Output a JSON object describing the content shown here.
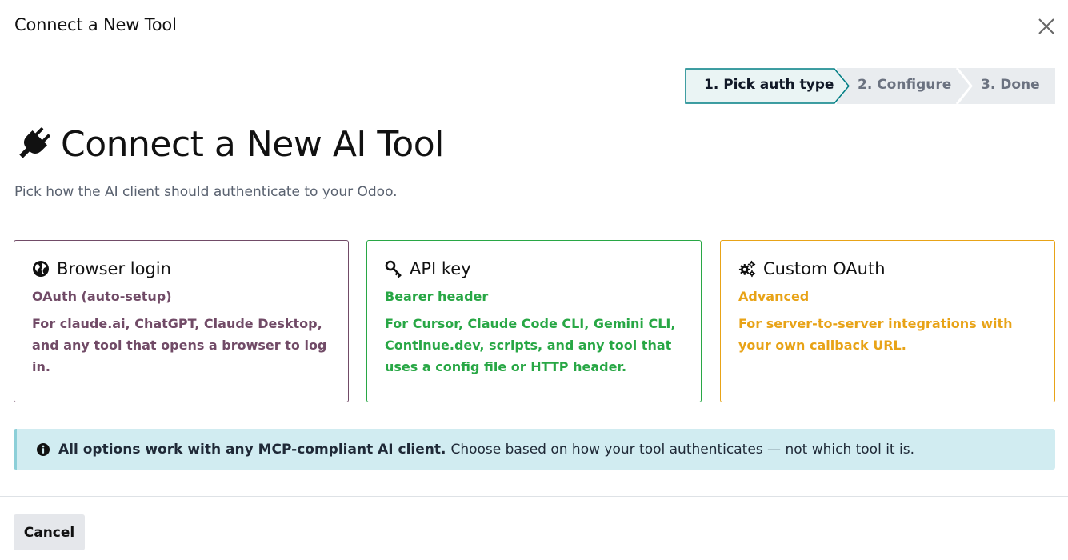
{
  "header": {
    "title": "Connect a New Tool"
  },
  "steps": [
    {
      "label": "1. Pick auth type",
      "active": true
    },
    {
      "label": "2. Configure",
      "active": false
    },
    {
      "label": "3. Done",
      "active": false
    }
  ],
  "main": {
    "title": "Connect a New AI Tool",
    "title_icon": "plug-icon",
    "subtitle": "Pick how the AI client should authenticate to your Odoo."
  },
  "cards": [
    {
      "icon": "globe-icon",
      "title": "Browser login",
      "tag": "OAuth (auto-setup)",
      "description": "For claude.ai, ChatGPT, Claude Desktop, and any tool that opens a browser to log in.",
      "color": "#714B67"
    },
    {
      "icon": "key-icon",
      "title": "API key",
      "tag": "Bearer header",
      "description": "For Cursor, Claude Code CLI, Gemini CLI, Continue.dev, scripts, and any tool that uses a config file or HTTP header.",
      "color": "#28a745"
    },
    {
      "icon": "gears-icon",
      "title": "Custom OAuth",
      "tag": "Advanced",
      "description": "For server-to-server integrations with your own callback URL.",
      "color": "#e8a317"
    }
  ],
  "info": {
    "icon": "info-circle-icon",
    "bold": "All options work with any MCP-compliant AI client.",
    "text": "Choose based on how your tool authenticates — not which tool it is."
  },
  "footer": {
    "cancel_label": "Cancel"
  },
  "colors": {
    "active_step_border": "#017e84",
    "info_bg": "#d1ecf1",
    "step_bg": "#e9ecef"
  }
}
